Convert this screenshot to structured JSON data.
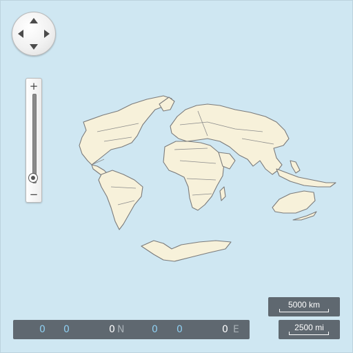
{
  "map": {
    "ocean_color": "#cfe7f2",
    "land_color": "#f7f1da",
    "border_color": "#7a7a7a"
  },
  "pan_control": {
    "icons": [
      "arrow-up-icon",
      "arrow-down-icon",
      "arrow-left-icon",
      "arrow-right-icon"
    ]
  },
  "zoom_control": {
    "plus_label": "+",
    "minus_label": "−",
    "level": 0.05
  },
  "coordinates": {
    "lat_deg": "0",
    "lat_min": "0",
    "lat_sec": "0",
    "lat_hemi": "N",
    "lon_deg": "0",
    "lon_min": "0",
    "lon_sec": "0",
    "lon_hemi": "E"
  },
  "scale": {
    "km_label": "5000 km",
    "mi_label": "2500 mi"
  }
}
